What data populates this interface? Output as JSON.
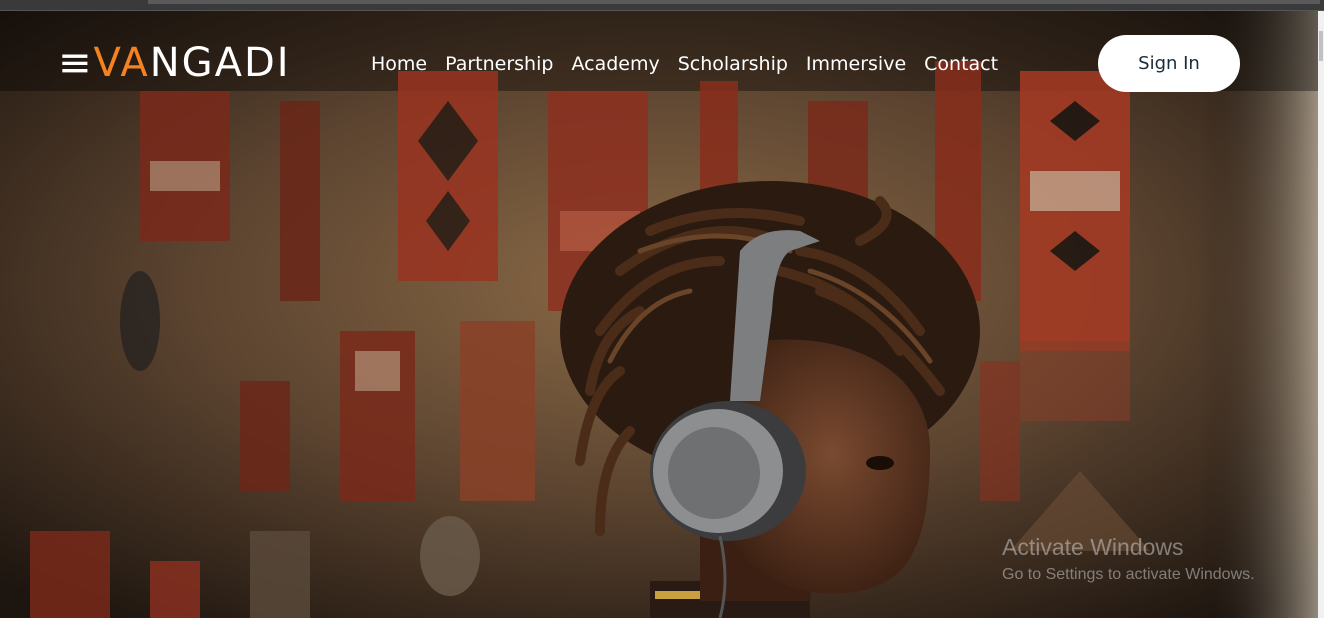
{
  "logo": {
    "prefix": "≡",
    "accent": "VA",
    "suffix": "NGADI",
    "accent_color": "#f58220"
  },
  "nav": {
    "items": [
      {
        "label": "Home"
      },
      {
        "label": "Partnership"
      },
      {
        "label": "Academy"
      },
      {
        "label": "Scholarship"
      },
      {
        "label": "Immersive"
      },
      {
        "label": "Contact"
      }
    ],
    "signin_label": "Sign In"
  },
  "hero": {
    "image_icon": "child-with-headphones-image"
  },
  "watermark": {
    "title": "Activate Windows",
    "subtitle": "Go to Settings to activate Windows."
  }
}
